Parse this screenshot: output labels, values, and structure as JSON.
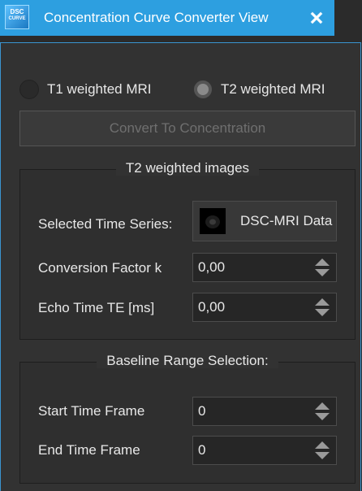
{
  "window": {
    "title": "Concentration Curve Converter View",
    "icon_text_top": "DSC",
    "icon_text_bottom": "CURVE"
  },
  "mode": {
    "options": [
      {
        "label": "T1 weighted MRI",
        "checked": false
      },
      {
        "label": "T2 weighted MRI",
        "checked": true
      }
    ]
  },
  "convert_button": {
    "label": "Convert To Concentration",
    "enabled": false
  },
  "t2_group": {
    "title": "T2 weighted images",
    "selected_series_label": "Selected Time Series:",
    "selected_series_value": "DSC-MRI Data",
    "conversion_factor_label": "Conversion Factor k",
    "conversion_factor_value": "0,00",
    "echo_time_label": "Echo Time TE [ms]",
    "echo_time_value": "0,00"
  },
  "baseline_group": {
    "title": "Baseline Range Selection:",
    "start_label": "Start Time Frame",
    "start_value": "0",
    "end_label": "End Time Frame",
    "end_value": "0"
  },
  "colors": {
    "title_bar": "#2d9fe0",
    "background": "#2b2b2b",
    "panel_border": "#3a94d0"
  },
  "icons": [
    "app-logo-icon",
    "close-icon",
    "spin-up-icon",
    "spin-down-icon",
    "image-thumbnail-icon"
  ]
}
